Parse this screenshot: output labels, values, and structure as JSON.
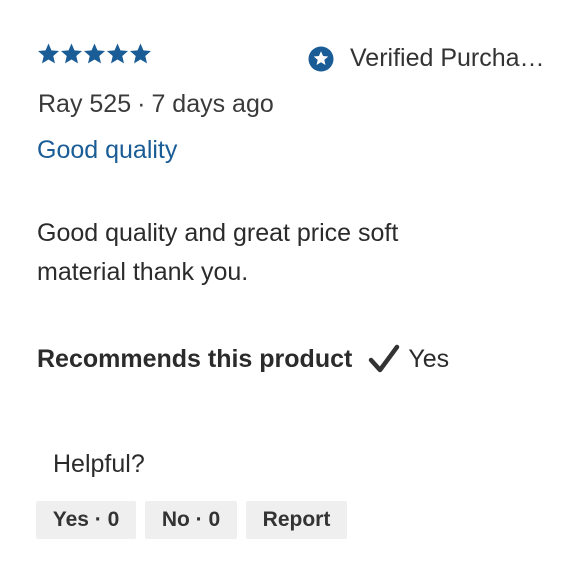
{
  "review": {
    "rating": 5,
    "max_rating": 5,
    "star_color": "#1a5c96",
    "verified_label": "Verified Purcha…",
    "author": "Ray 525",
    "separator": "·",
    "date": "7 days ago",
    "title": "Good quality",
    "body": "Good quality and great price soft material thank you.",
    "recommends_label": "Recommends this product",
    "recommends_value": "Yes",
    "helpful_label": "Helpful?",
    "buttons": {
      "yes": "Yes · 0",
      "no": "No · 0",
      "report": "Report"
    },
    "icons": {
      "star": "star-icon",
      "verified": "verified-star-badge-icon",
      "check": "checkmark-icon"
    },
    "colors": {
      "accent": "#1a5c96",
      "text": "#2b2b2b",
      "button_bg": "#efefef"
    }
  }
}
